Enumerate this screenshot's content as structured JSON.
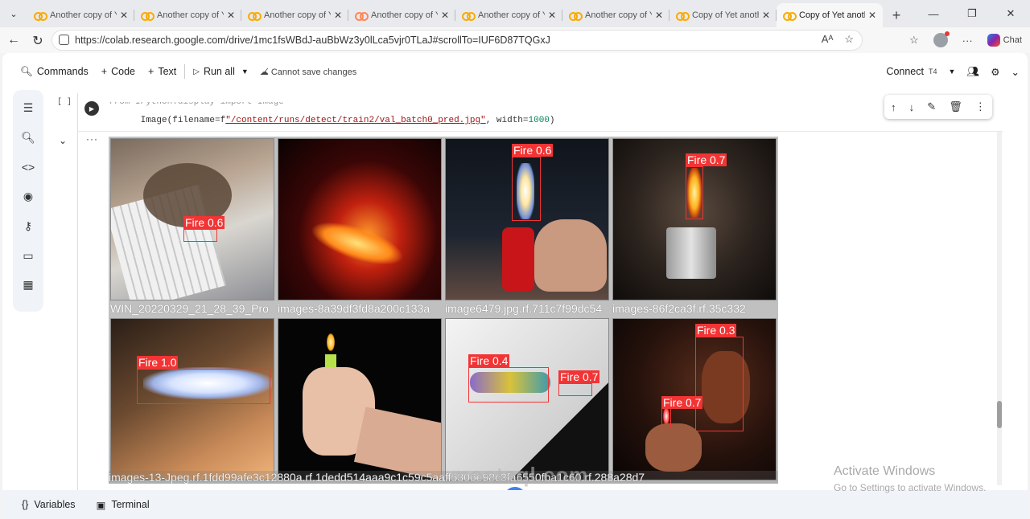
{
  "browser": {
    "tabs": [
      {
        "title": "Another copy of Ye",
        "active": false
      },
      {
        "title": "Another copy of Ye",
        "active": false
      },
      {
        "title": "Another copy of Ye",
        "active": false
      },
      {
        "title": "Another copy of Ye",
        "active": false
      },
      {
        "title": "Another copy of YC",
        "active": false
      },
      {
        "title": "Another copy of YC",
        "active": false
      },
      {
        "title": "Copy of Yet anothe",
        "active": false
      },
      {
        "title": "Copy of Yet anothe",
        "active": true
      }
    ],
    "url": "https://colab.research.google.com/drive/1mc1fsWBdJ-auBbWz3y0lLca5vjr0TLaJ#scrollTo=IUF6D87TQGxJ",
    "chat_label": "Chat"
  },
  "colab": {
    "toolbar": {
      "commands": "Commands",
      "code": "Code",
      "text": "Text",
      "run_all": "Run all",
      "cannot_save": "Cannot save changes",
      "connect": "Connect",
      "runtime": "T4"
    },
    "cell": {
      "bracket": "[ ]",
      "line1": "from IPython.display import Image",
      "line2_pre": "Image(filename=f",
      "line2_str": "\"/content/runs/detect/train2/val_batch0_pred.jpg\"",
      "line2_mid": ", width=",
      "line2_num": "1000",
      "line2_end": ")"
    },
    "output": {
      "images": [
        {
          "caption": "WIN_20220329_21_28_39_Pro",
          "detections": [
            {
              "label": "Fire 0.6"
            }
          ]
        },
        {
          "caption": "images-8a39df3fd8a200c133a",
          "detections": []
        },
        {
          "caption": "image6479.jpg.rf.711c7f99dc54",
          "detections": [
            {
              "label": "Fire 0.6"
            }
          ]
        },
        {
          "caption": "images-86f2ca3f.rf.35c332",
          "detections": [
            {
              "label": "Fire 0.7"
            }
          ]
        },
        {
          "caption": "",
          "detections": [
            {
              "label": "Fire 1.0"
            }
          ]
        },
        {
          "caption": "",
          "detections": []
        },
        {
          "caption": "",
          "detections": [
            {
              "label": "Fire 0.4"
            },
            {
              "label": "Fire 0.7"
            }
          ]
        },
        {
          "caption": "",
          "detections": [
            {
              "label": "Fire 0.3"
            },
            {
              "label": "Fire 0.7"
            }
          ]
        }
      ],
      "bottom_caption": "images-13-Jpeg.rf.1fdd99afe3c12880a.rf.1dedd514aaa9c1c59c5aaff5306e98c3fa6550fba1c60.rf.288a28d7"
    },
    "bottom": {
      "variables": "Variables",
      "terminal": "Terminal"
    }
  },
  "overlays": {
    "activate_title": "Activate Windows",
    "activate_sub": "Go to Settings to activate Windows.",
    "watermark": "mostaql.com"
  },
  "colors": {
    "box": "#f23434",
    "accent": "#f9ab00"
  }
}
